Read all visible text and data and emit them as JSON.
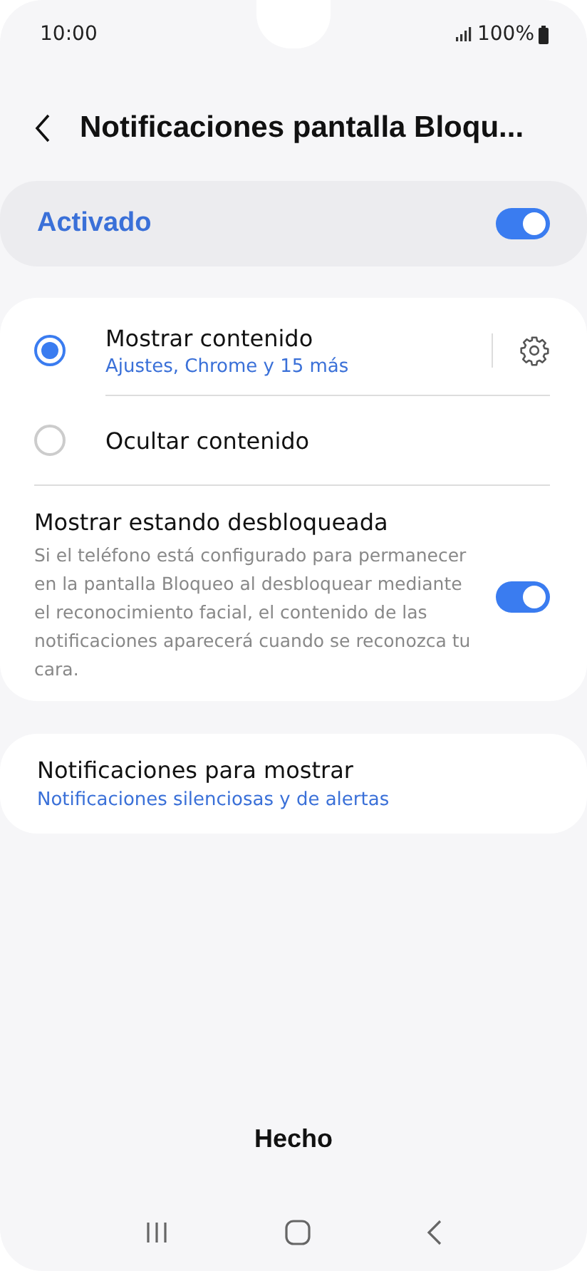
{
  "status_bar": {
    "time": "10:00",
    "battery": "100%"
  },
  "header": {
    "title": "Notificaciones pantalla Bloqu..."
  },
  "master": {
    "label": "Activado",
    "on": true
  },
  "options": [
    {
      "label": "Mostrar contenido",
      "sublabel": "Ajustes, Chrome y 15 más",
      "selected": true,
      "settings": true
    },
    {
      "label": "Ocultar contenido",
      "selected": false,
      "settings": false
    }
  ],
  "unlocked": {
    "label": "Mostrar estando desbloqueada",
    "description": "Si el teléfono está configurado para permanecer en la pantalla Bloqueo al desbloquear mediante el reconocimiento facial, el contenido de las notificaciones aparecerá cuando se reconozca tu cara.",
    "on": true
  },
  "show": {
    "label": "Notificaciones para mostrar",
    "value": "Notificaciones silenciosas y de alertas"
  },
  "done_button": "Hecho"
}
